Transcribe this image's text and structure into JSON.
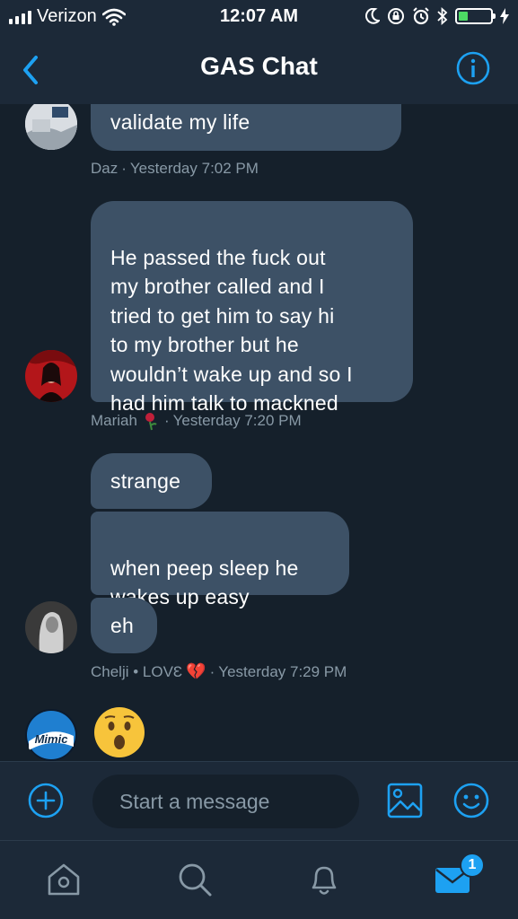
{
  "status_bar": {
    "carrier": "Verizon",
    "time": "12:07 AM",
    "battery_level": 0.3
  },
  "header": {
    "title": "GAS Chat",
    "back_icon": "chevron-left-icon",
    "info_icon": "info-icon"
  },
  "messages": [
    {
      "text": "validate my life",
      "meta_name": "Daz",
      "meta_time": "Yesterday 7:02 PM"
    },
    {
      "text": "He passed the fuck out\nmy brother called and I\ntried to get him to say hi\nto my brother but he\nwouldn’t wake up and so I\nhad him talk to mackned",
      "meta_name": "Mariah",
      "meta_time": "Yesterday 7:20 PM"
    },
    {
      "text": "strange"
    },
    {
      "text": "when peep sleep he\nwakes up easy"
    },
    {
      "text": "eh",
      "meta_name": "Chelji • LOVƐ",
      "meta_time": "Yesterday 7:29 PM"
    }
  ],
  "meta_sep": "·",
  "last_message_emoji": "hushed-face-emoji",
  "avatars": {
    "mimic_logo_text": "Mimic"
  },
  "compose": {
    "placeholder": "Start a message",
    "add_icon": "plus-circle-icon",
    "image_icon": "image-icon",
    "emoji_icon": "smiley-icon"
  },
  "tabs": {
    "home": "home-icon",
    "search": "search-icon",
    "notifications": "bell-icon",
    "messages": "mail-icon",
    "messages_badge": "1"
  },
  "colors": {
    "accent": "#1da1f2",
    "background": "#15202b",
    "bar": "#1c2938",
    "bubble": "#3d5166",
    "meta_text": "#8899a6"
  }
}
